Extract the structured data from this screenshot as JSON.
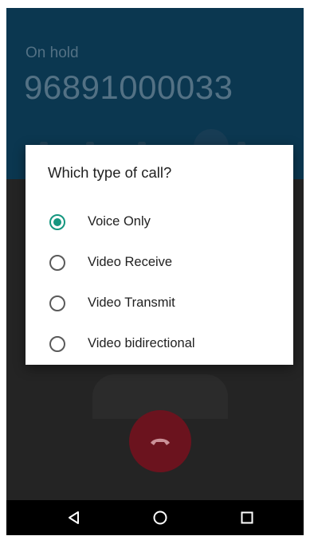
{
  "call": {
    "status": "On hold",
    "number": "96891000033"
  },
  "dialog": {
    "title": "Which type of call?",
    "options": [
      {
        "label": "Voice Only",
        "selected": true
      },
      {
        "label": "Video Receive",
        "selected": false
      },
      {
        "label": "Video Transmit",
        "selected": false
      },
      {
        "label": "Video bidirectional",
        "selected": false
      }
    ]
  },
  "icons": {
    "end_call": "end-call-icon",
    "back": "back-triangle-icon",
    "home": "home-circle-icon",
    "recents": "recents-square-icon"
  },
  "colors": {
    "header": "#0d3f5c",
    "accent": "#14967f",
    "end_call": "#7a1623",
    "nav_bar": "#000000"
  }
}
